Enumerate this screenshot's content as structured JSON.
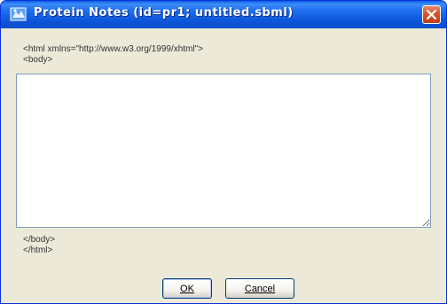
{
  "window": {
    "title": "Protein Notes (id=pr1; untitled.sbml)",
    "icon": "sbml-app-icon",
    "close_icon": "close-icon"
  },
  "notes": {
    "html_open": "<html xmlns=\"http://www.w3.org/1999/xhtml\">",
    "body_open": "<body>",
    "body_close": "</body>",
    "html_close": "</html>",
    "content": ""
  },
  "buttons": {
    "ok_label": "OK",
    "cancel_label": "Cancel"
  },
  "colors": {
    "titlebar": "#0c55d8",
    "close_button": "#d8542a",
    "dialog_bg": "#ece9d8",
    "input_border": "#7f9db9"
  }
}
